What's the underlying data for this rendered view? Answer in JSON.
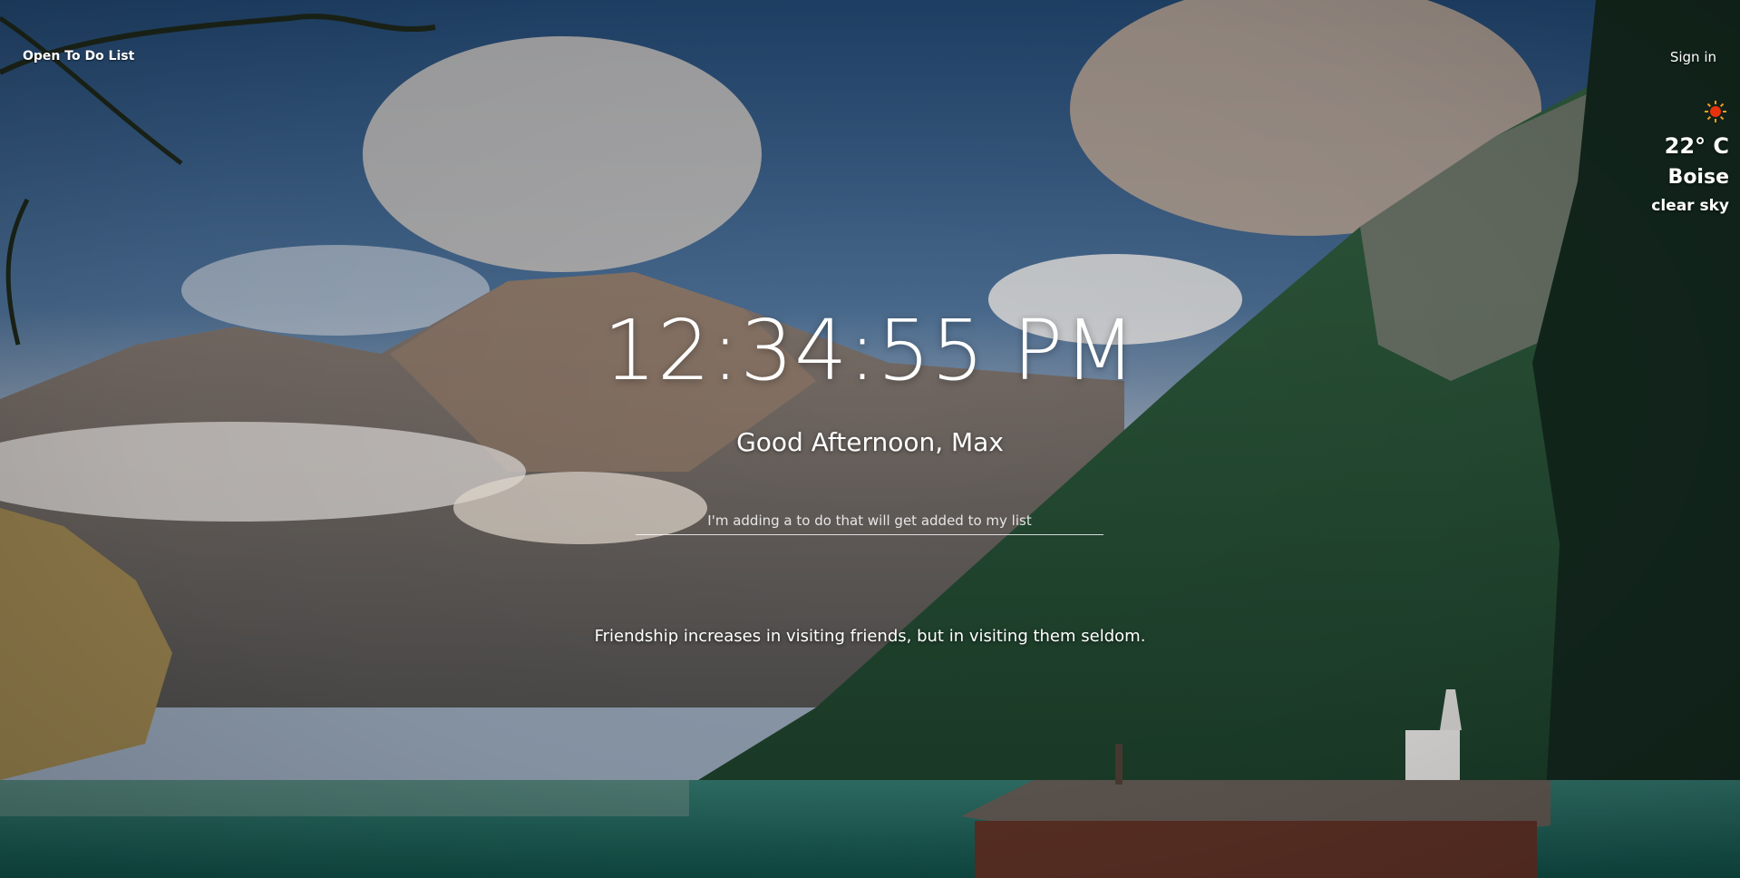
{
  "top_left": {
    "todo_link_label": "Open To Do List"
  },
  "top_right": {
    "signin_label": "Sign in"
  },
  "weather": {
    "icon": "sun-icon",
    "temperature": "22° C",
    "city": "Boise",
    "description": "clear sky"
  },
  "center": {
    "time": "12:34:55 PM",
    "greeting": "Good Afternoon, Max",
    "todo_input_placeholder": "I'm adding a to do that will get added to my list",
    "quote": "Friendship increases in visiting friends, but in visiting them seldom."
  },
  "colors": {
    "text": "#ffffff",
    "sun": "#e8320c"
  }
}
